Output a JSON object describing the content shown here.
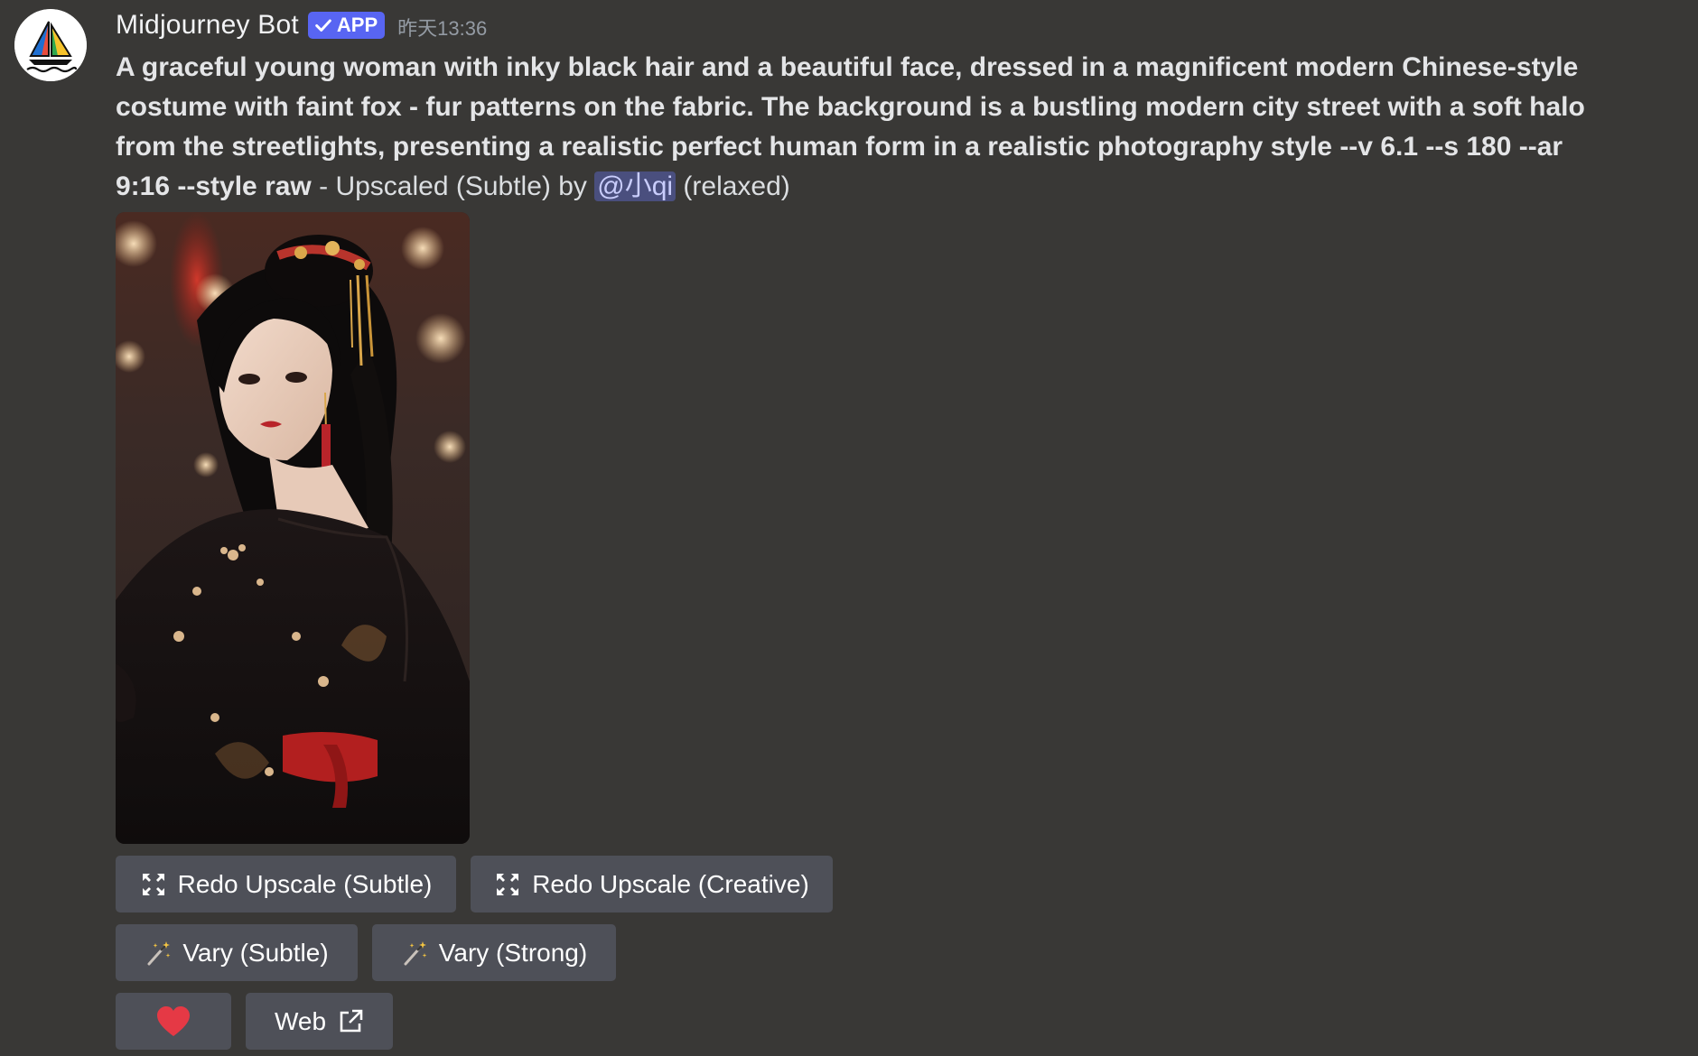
{
  "message": {
    "username": "Midjourney Bot",
    "badge": "APP",
    "timestamp": "昨天13:36",
    "prompt": "A graceful young woman with inky black hair and a beautiful face, dressed in a magnificent modern Chinese-style costume with faint fox - fur patterns on the fabric. The background is a bustling modern city street with a soft halo from the streetlights, presenting a realistic perfect human form in a realistic photography style --v 6.1 --s 180 --ar 9:16 --style raw",
    "suffix_before": " - Upscaled (Subtle) by ",
    "mention": "@小qi",
    "suffix_after": " (relaxed)"
  },
  "buttons": {
    "redo_subtle": "Redo Upscale (Subtle)",
    "redo_creative": "Redo Upscale (Creative)",
    "vary_subtle": "Vary (Subtle)",
    "vary_strong": "Vary (Strong)",
    "web": "Web"
  },
  "icons": {
    "upscale": "upscale-arrows-icon",
    "vary": "magic-wand-icon",
    "like": "heart-icon",
    "external": "external-link-icon"
  },
  "colors": {
    "background": "#393836",
    "button": "#4e5058",
    "badge": "#5865f2",
    "heart": "#e53945"
  }
}
